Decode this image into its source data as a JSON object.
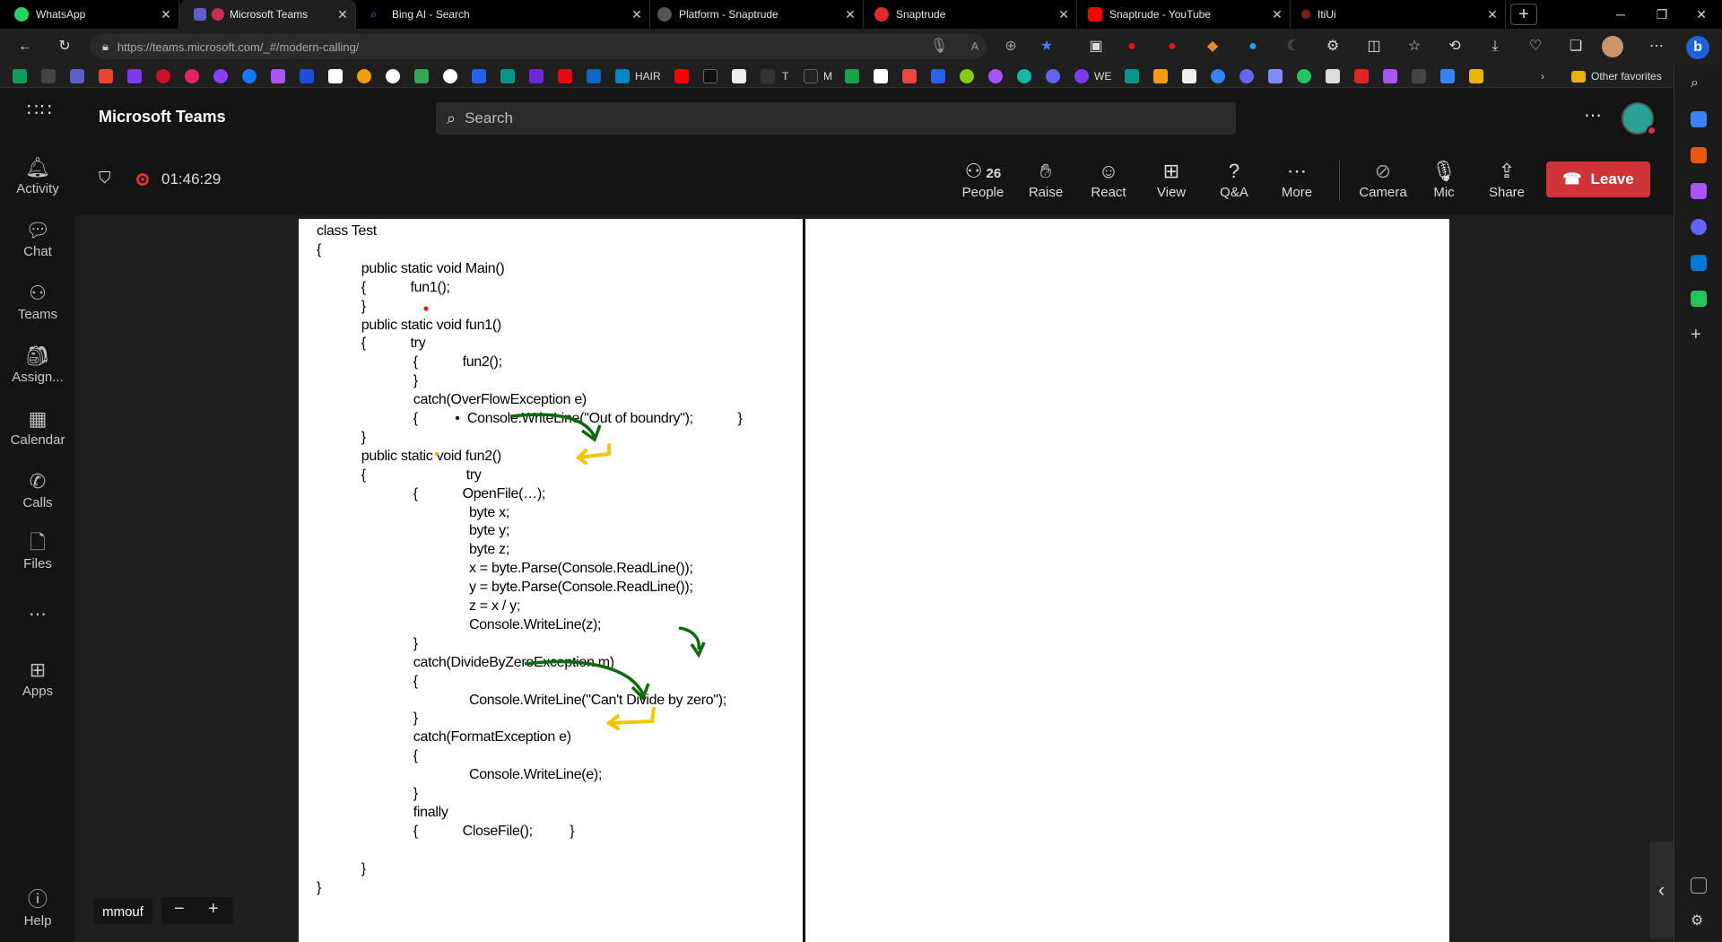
{
  "browser": {
    "tabs": [
      {
        "title": "WhatsApp",
        "color": "#25d366"
      },
      {
        "title": "Microsoft Teams",
        "color": "#c4314b"
      },
      {
        "title": "Bing AI - Search",
        "color": "#3b82f6"
      },
      {
        "title": "Platform - Snaptrude",
        "color": "#888888"
      },
      {
        "title": "Snaptrude",
        "color": "#e0282e"
      },
      {
        "title": "Snaptrude - YouTube",
        "color": "#ff0000"
      },
      {
        "title": "ItiUi",
        "color": "#b91c1c"
      }
    ],
    "url": "https://teams.microsoft.com/_#/modern-calling/",
    "url_host": "teams.microsoft.com",
    "favorites_labels": [
      "HAIR",
      "T",
      "M",
      "WE"
    ],
    "other_favorites": "Other favorites"
  },
  "teams": {
    "app_title": "Microsoft Teams",
    "search_placeholder": "Search",
    "rail": [
      "Activity",
      "Chat",
      "Teams",
      "Assign...",
      "Calendar",
      "Calls",
      "Files",
      "Apps",
      "Help"
    ],
    "meeting": {
      "timer": "01:46:29",
      "people_count": "26",
      "controls": [
        "People",
        "Raise",
        "React",
        "View",
        "Q&A",
        "More",
        "Camera",
        "Mic",
        "Share"
      ],
      "leave": "Leave",
      "presenter": "mmouf"
    }
  },
  "code_lines": [
    "class Test",
    "{",
    "            public static void Main()",
    "            {            fun1();",
    "            }",
    "            public static void fun1()",
    "            {            try",
    "                          {            fun2();",
    "                          }",
    "                          catch(OverFlowException e)",
    "                          {          •  Console.WriteLine(\"Out of boundry\");            }",
    "            }",
    "            public static void fun2()",
    "            {                           try",
    "                          {            OpenFile(…);",
    "                                         byte x;",
    "                                         byte y;",
    "                                         byte z;",
    "                                         x = byte.Parse(Console.ReadLine());",
    "                                         y = byte.Parse(Console.ReadLine());",
    "                                         z = x / y;",
    "                                         Console.WriteLine(z);",
    "                          }",
    "                          catch(DivideByZeroException m)",
    "                          {",
    "                                         Console.WriteLine(\"Can't Divide by zero\");",
    "                          }",
    "                          catch(FormatException e)",
    "                          {",
    "                                         Console.WriteLine(e);",
    "                          }",
    "                          finally",
    "                          {            CloseFile();          }",
    "",
    "            }",
    "}"
  ]
}
